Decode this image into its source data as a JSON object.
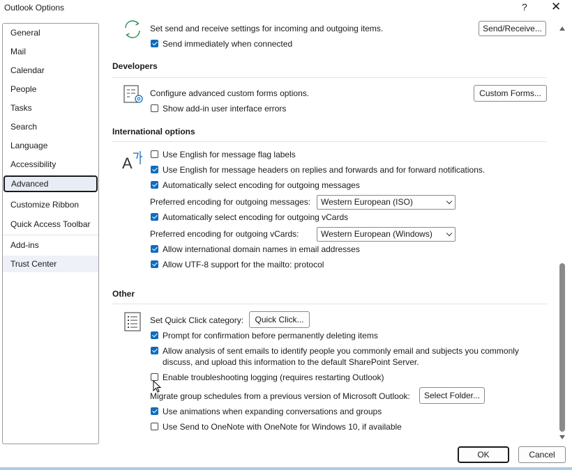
{
  "window": {
    "title": "Outlook Options",
    "help_label": "?",
    "close_label": "✕"
  },
  "nav": {
    "items": [
      "General",
      "Mail",
      "Calendar",
      "People",
      "Tasks",
      "Search",
      "Language",
      "Accessibility",
      "Advanced",
      "Customize Ribbon",
      "Quick Access Toolbar",
      "Add-ins",
      "Trust Center"
    ],
    "selected": "Advanced"
  },
  "send_receive": {
    "description": "Set send and receive settings for incoming and outgoing items.",
    "button": "Send/Receive...",
    "send_immediately": {
      "label": "Send immediately when connected",
      "checked": true
    }
  },
  "developers": {
    "title": "Developers",
    "description": "Configure advanced custom forms options.",
    "button": "Custom Forms...",
    "show_addin_errors": {
      "label": "Show add-in user interface errors",
      "checked": false
    }
  },
  "international": {
    "title": "International options",
    "english_flag_labels": {
      "label": "Use English for message flag labels",
      "checked": false
    },
    "english_headers": {
      "label": "Use English for message headers on replies and forwards and for forward notifications.",
      "checked": true
    },
    "auto_encoding_outgoing": {
      "label": "Automatically select encoding for outgoing messages",
      "checked": true
    },
    "preferred_encoding_label": "Preferred encoding for outgoing messages:",
    "preferred_encoding_value": "Western European (ISO)",
    "auto_encoding_vcards": {
      "label": "Automatically select encoding for outgoing vCards",
      "checked": true
    },
    "preferred_vcard_label": "Preferred encoding for outgoing vCards:",
    "preferred_vcard_value": "Western European (Windows)",
    "intl_domain_names": {
      "label": "Allow international domain names in email addresses",
      "checked": true
    },
    "utf8_mailto": {
      "label": "Allow UTF-8 support for the mailto: protocol",
      "checked": true
    }
  },
  "other": {
    "title": "Other",
    "quick_click_label": "Set Quick Click category:",
    "quick_click_button": "Quick Click...",
    "prompt_delete": {
      "label": "Prompt for confirmation before permanently deleting items",
      "checked": true
    },
    "allow_analysis": {
      "label_line1": "Allow analysis of sent emails to identify people you commonly email and subjects you commonly",
      "label_line2": "discuss, and upload this information to the default SharePoint Server.",
      "checked": true
    },
    "troubleshooting": {
      "label": "Enable troubleshooting logging (requires restarting Outlook)",
      "checked": false
    },
    "migrate_label": "Migrate group schedules from a previous version of Microsoft Outlook:",
    "select_folder_button": "Select Folder...",
    "use_animations": {
      "label": "Use animations when expanding conversations and groups",
      "checked": true
    },
    "onenote": {
      "label": "Use Send to OneNote with OneNote for Windows 10, if available",
      "checked": false
    }
  },
  "footer": {
    "ok": "OK",
    "cancel": "Cancel"
  },
  "colors": {
    "accent": "#0f6cbd",
    "selected_bg": "#e8ecf5"
  }
}
